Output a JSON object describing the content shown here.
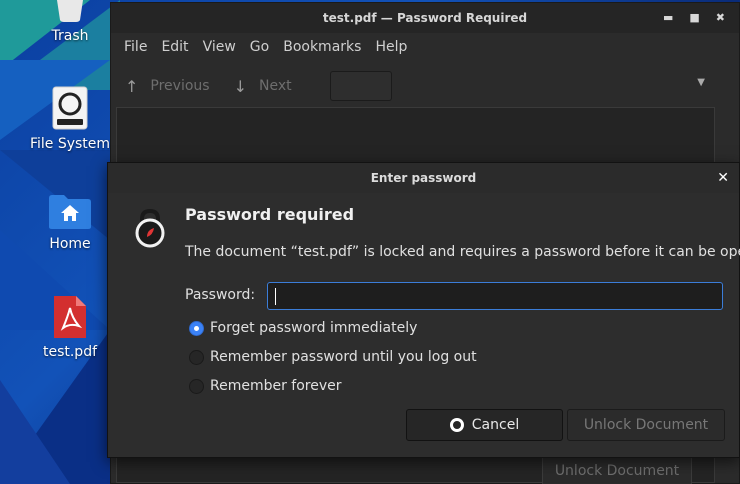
{
  "desktop": {
    "icons": [
      {
        "label": "Trash",
        "icon": "trash-icon"
      },
      {
        "label": "File System",
        "icon": "drive-icon"
      },
      {
        "label": "Home",
        "icon": "home-folder-icon"
      },
      {
        "label": "test.pdf",
        "icon": "pdf-file-icon"
      }
    ]
  },
  "window": {
    "title": "test.pdf — Password Required",
    "controls": {
      "minimize": "▬",
      "maximize": "■",
      "close": "✖"
    },
    "menu": [
      "File",
      "Edit",
      "View",
      "Go",
      "Bookmarks",
      "Help"
    ],
    "toolbar": {
      "previous_label": "Previous",
      "next_label": "Next",
      "prev_icon": "↑",
      "next_icon": "↓",
      "dropdown_icon": "▼"
    },
    "background_unlock_label": "Unlock Document"
  },
  "dialog": {
    "title": "Enter password",
    "close_icon": "✕",
    "heading": "Password required",
    "message": "The document “test.pdf” is locked and requires a password before it can be opened.",
    "password_label": "Password:",
    "password_value": "",
    "options": [
      {
        "label": "Forget password immediately",
        "selected": true
      },
      {
        "label": "Remember password until you log out",
        "selected": false
      },
      {
        "label": "Remember forever",
        "selected": false
      }
    ],
    "cancel_label": "Cancel",
    "unlock_label": "Unlock Document"
  },
  "colors": {
    "accent": "#3b82f6",
    "dialog_bg": "#2d2d2d",
    "window_bg": "#2b2b2b",
    "pdf_red": "#d32f2f",
    "folder_blue": "#2f7fe0"
  }
}
